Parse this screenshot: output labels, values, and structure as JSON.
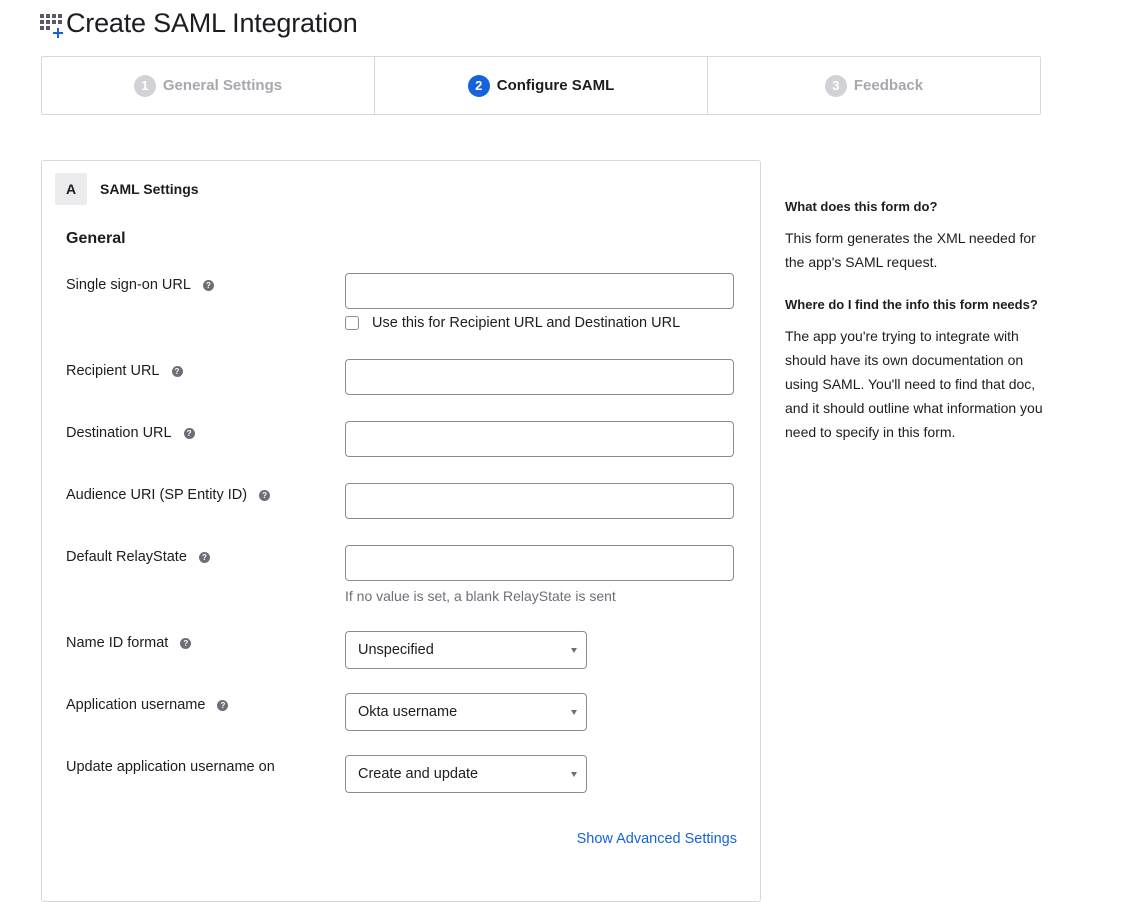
{
  "page": {
    "title": "Create SAML Integration",
    "icon": "grid-add-icon"
  },
  "steps": [
    {
      "number": "1",
      "label": "General Settings",
      "state": "inactive"
    },
    {
      "number": "2",
      "label": "Configure SAML",
      "state": "active"
    },
    {
      "number": "3",
      "label": "Feedback",
      "state": "inactive"
    }
  ],
  "section": {
    "badge": "A",
    "title": "SAML Settings",
    "group_title": "General"
  },
  "fields": {
    "sso_url": {
      "label": "Single sign-on URL",
      "value": "",
      "help_icon": "help-circle-icon"
    },
    "use_for_recipient": {
      "label": "Use this for Recipient URL and Destination URL",
      "checked": false
    },
    "recipient_url": {
      "label": "Recipient URL",
      "value": "",
      "help_icon": "help-circle-icon"
    },
    "destination_url": {
      "label": "Destination URL",
      "value": "",
      "help_icon": "help-circle-icon"
    },
    "audience_uri": {
      "label": "Audience URI (SP Entity ID)",
      "value": "",
      "help_icon": "help-circle-icon"
    },
    "relay_state": {
      "label": "Default RelayState",
      "value": "",
      "hint": "If no value is set, a blank RelayState is sent",
      "help_icon": "help-circle-icon"
    },
    "name_id_format": {
      "label": "Name ID format",
      "selected": "Unspecified",
      "help_icon": "help-circle-icon"
    },
    "app_username": {
      "label": "Application username",
      "selected": "Okta username",
      "help_icon": "help-circle-icon"
    },
    "update_username_on": {
      "label": "Update application username on",
      "selected": "Create and update"
    }
  },
  "advanced_link": "Show Advanced Settings",
  "help": [
    {
      "question": "What does this form do?",
      "answer": "This form generates the XML needed for the app's SAML request."
    },
    {
      "question": "Where do I find the info this form needs?",
      "answer": "The app you're trying to integrate with should have its own documentation on using SAML. You'll need to find that doc, and it should outline what information you need to specify in this form."
    }
  ],
  "colors": {
    "accent": "#1662dd",
    "border": "#d7d7dc",
    "muted_text": "#6e6e78"
  }
}
